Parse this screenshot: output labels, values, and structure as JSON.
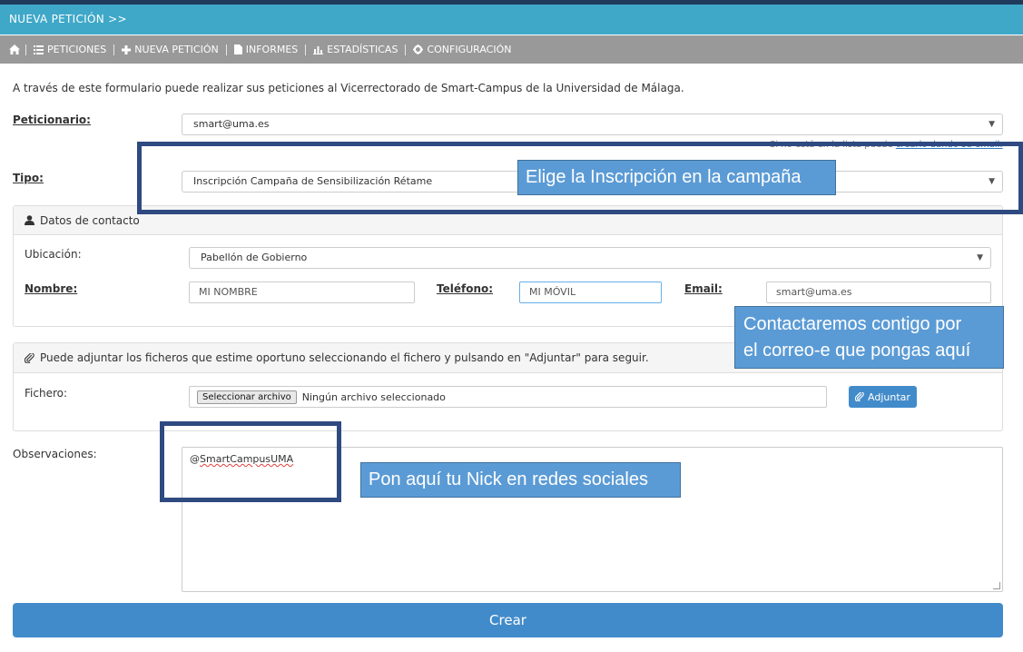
{
  "header": {
    "title": "NUEVA PETICIÓN >>"
  },
  "nav": {
    "home_icon": "home-icon",
    "items": [
      {
        "label": "PETICIONES",
        "icon": "list-icon"
      },
      {
        "label": "NUEVA PETICIÓN",
        "icon": "plus-icon"
      },
      {
        "label": "INFORMES",
        "icon": "file-icon"
      },
      {
        "label": "ESTADÍSTICAS",
        "icon": "bar-chart-icon"
      },
      {
        "label": "CONFIGURACIÓN",
        "icon": "gear-icon"
      }
    ]
  },
  "intro": "A través de este formulario puede realizar sus peticiones al Vicerrectorado de Smart-Campus de la Universidad de Málaga.",
  "peticionario": {
    "label": "Peticionario:",
    "value": "smart@uma.es"
  },
  "hint": {
    "text": "Si no está en la lista puede ",
    "link": "crearlo dando su email."
  },
  "tipo": {
    "label": "Tipo:",
    "value": "Inscripción Campaña de Sensibilización Rétame"
  },
  "contact_panel": {
    "title": "Datos de contacto",
    "ubicacion_label": "Ubicación:",
    "ubicacion_value": "Pabellón de Gobierno",
    "nombre_label": "Nombre:",
    "nombre_value": "MI NOMBRE",
    "telefono_label": "Teléfono:",
    "telefono_value": "MI MÓVIL",
    "email_label": "Email:",
    "email_value": "smart@uma.es"
  },
  "attach_panel": {
    "title": "Puede adjuntar los ficheros que estime oportuno seleccionando el fichero y pulsando en \"Adjuntar\" para seguir.",
    "fichero_label": "Fichero:",
    "file_button": "Seleccionar archivo",
    "file_status": "Ningún archivo seleccionado",
    "attach_button": "Adjuntar"
  },
  "observaciones": {
    "label": "Observaciones:",
    "value": "@SmartCampusUMA"
  },
  "submit": {
    "label": "Crear"
  },
  "callouts": {
    "tipo": "Elige la Inscripción en la campaña",
    "email_line1": "Contactaremos contigo por",
    "email_line2": "el correo-e que pongas aquí",
    "nick": "Pon aquí tu Nick en redes sociales"
  },
  "colors": {
    "titlebar": "#3fa8c8",
    "navbar": "#999999",
    "primary": "#428bca",
    "callout": "#5b9bd5",
    "frame": "#2f4a80"
  }
}
